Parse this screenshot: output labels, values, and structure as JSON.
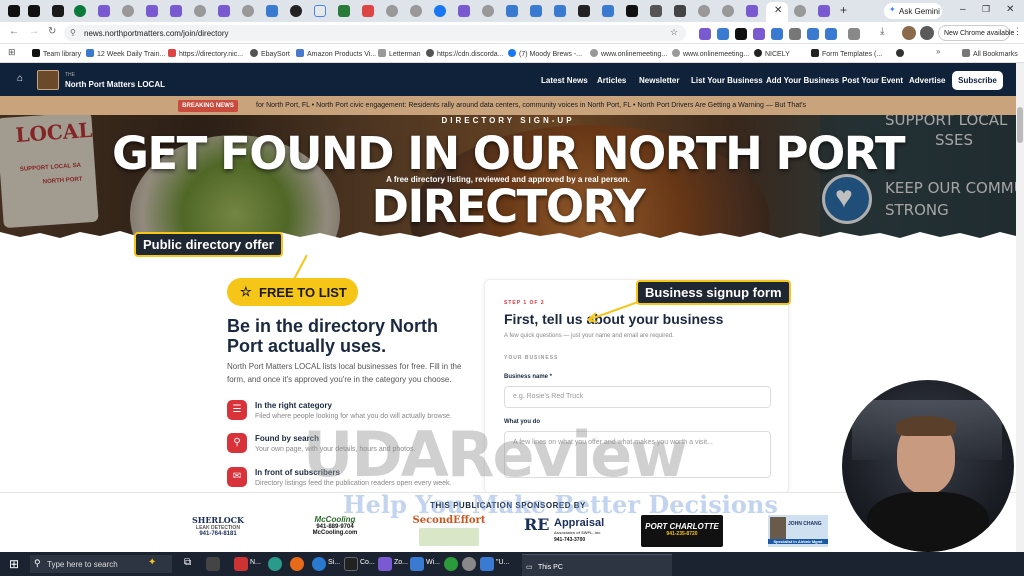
{
  "browser": {
    "url": "news.northportmatters.com/join/directory",
    "ask_gemini": "Ask Gemini",
    "new_chrome": "New Chrome available",
    "bookmarks": [
      "Team library",
      "12 Week Daily Train...",
      "https://directory.nic...",
      "EbaySort",
      "Amazon Products Vi...",
      "Letterman",
      "https://cdn.discorda...",
      "(7) Moody Brews -...",
      "www.onlinemeeting...",
      "www.onlinemeeting...",
      "NICELY",
      "Form Templates (...",
      ""
    ],
    "all_bookmarks": "All Bookmarks"
  },
  "site": {
    "logo_small": "THE",
    "logo_name": "North Port Matters LOCAL",
    "nav": [
      "Latest News",
      "Articles",
      "Newsletter",
      "List Your Business",
      "Add Your Business",
      "Post Your Event",
      "Advertise"
    ],
    "subscribe": "Subscribe",
    "breaking_label": "BREAKING NEWS",
    "ticker": "for North Port, FL  •  North Port civic engagement: Residents rally around data centers, community voices in North Port, FL  •  North Port Drivers Are Getting a Warning — But That's"
  },
  "hero": {
    "eyebrow": "DIRECTORY SIGN-UP",
    "title": "GET FOUND IN OUR NORTH PORT DIRECTORY",
    "subtitle": "A free directory listing, reviewed and approved by a real person.",
    "sign_left_1": "LOCAL",
    "sign_left_2": "SUPPORT LOCAL SA",
    "sign_left_3": "NORTH PORT",
    "sign_right_1": "SUPPORT LOCAL",
    "sign_right_2": "SSES",
    "sign_right_3": "KEEP OUR COMMUN",
    "sign_right_4": "STRONG"
  },
  "callouts": {
    "public_offer": "Public directory offer",
    "business_form": "Business signup form"
  },
  "left": {
    "free_button": "FREE TO LIST",
    "heading": "Be in the directory North Port actually uses.",
    "paragraph": "North Port Matters LOCAL lists local businesses for free. Fill in the form, and once it's approved you're in the category you choose.",
    "features": [
      {
        "title": "In the right category",
        "sub": "Filed where people looking for what you do will actually browse.",
        "icon": "list-icon"
      },
      {
        "title": "Found by search",
        "sub": "Your own page, with your details, hours and photos.",
        "icon": "search-icon"
      },
      {
        "title": "In front of subscribers",
        "sub": "Directory listings feed the publication readers open every week.",
        "icon": "mail-icon"
      }
    ]
  },
  "form": {
    "step": "STEP 1 OF 2",
    "title": "First, tell us about your business",
    "hint": "A few quick questions — just your name and email are required.",
    "section": "YOUR BUSINESS",
    "name_label": "Business name *",
    "name_placeholder": "e.g. Rosie's Red Truck",
    "what_label": "What you do",
    "what_placeholder": "A few lines on what you offer and what makes you worth a visit..."
  },
  "sponsors": {
    "heading": "THIS PUBLICATION SPONSORED BY",
    "list": [
      {
        "name": "SHERLOCK",
        "line2": "LEAK DETECTION",
        "line3": "941-764-8181",
        "color": "#1a2e5a"
      },
      {
        "name": "McCooling",
        "line2": "941-889-9704",
        "line3": "McCooling.com",
        "color": "#1a4a1a"
      },
      {
        "name": "SecondEffort",
        "line2": "",
        "line3": "",
        "color": "#c9541e"
      },
      {
        "name": "Appraisal",
        "line2": "Associates of SWFL, Inc",
        "line3": "941-743-3700",
        "color": "#1a2e5a"
      },
      {
        "name": "PORT CHARLOTTE",
        "line2": "941-235-8720",
        "line3": "",
        "color": "#111111"
      },
      {
        "name": "JOHN CHANG",
        "line2": "Specialist in Airbnb Mgmt",
        "line3": "",
        "color": "#1a5aa5"
      }
    ]
  },
  "watermark": {
    "big": "UDAReview",
    "small": "Help You Make Better Decisions"
  },
  "taskbar": {
    "search": "Type here to search",
    "items": [
      "N...",
      "Si...",
      "Co...",
      "Zo...",
      "Wi...",
      "\"U..."
    ],
    "this_pc": "This PC"
  },
  "colors": {
    "nav_bg": "#10213a",
    "accent": "#f5c518",
    "feature_red": "#d8323a",
    "ticker_bg": "#c8a37c"
  }
}
